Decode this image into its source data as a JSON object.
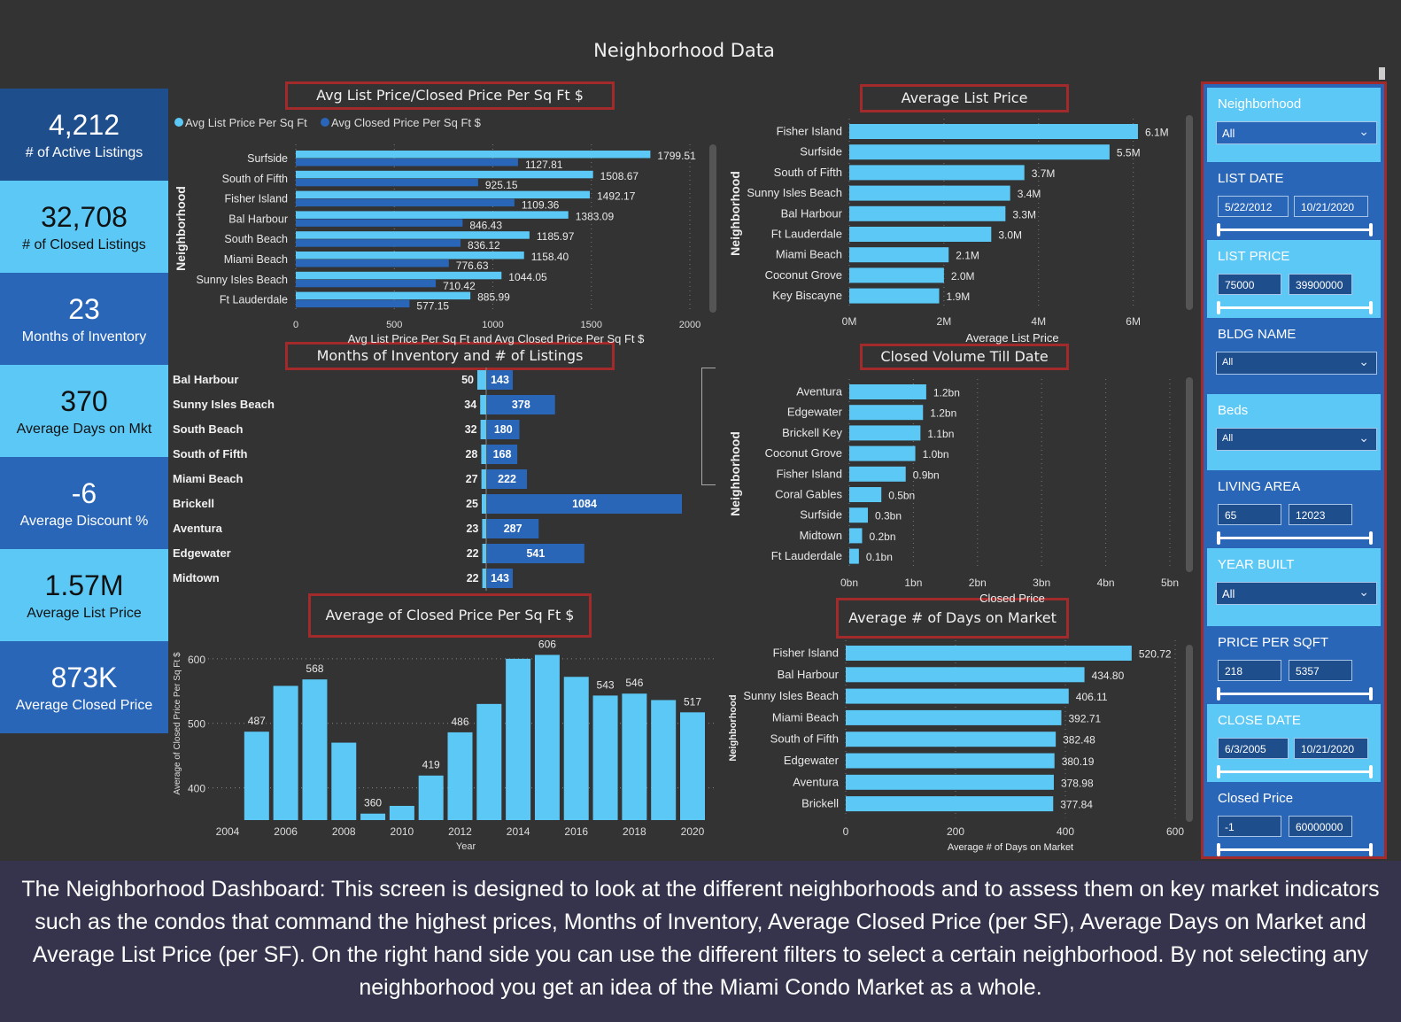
{
  "header": {
    "title": "Neighborhood Data"
  },
  "kpis": [
    {
      "value": "4,212",
      "label": "# of Active Listings"
    },
    {
      "value": "32,708",
      "label": "# of Closed Listings"
    },
    {
      "value": "23",
      "label": "Months of Inventory"
    },
    {
      "value": "370",
      "label": "Average Days on Mkt"
    },
    {
      "value": "-6",
      "label": "Average Discount %"
    },
    {
      "value": "1.57M",
      "label": "Average List Price"
    },
    {
      "value": "873K",
      "label": "Average Closed Price"
    }
  ],
  "colors": {
    "light_blue": "#5bc8f5",
    "mid_blue": "#2a66b8",
    "dark_blue": "#1f4e8c",
    "title_border": "#a32a2a",
    "background": "#333333"
  },
  "chart_data": [
    {
      "id": "ppsf",
      "type": "bar",
      "orientation": "horizontal",
      "title": "Avg List Price/Closed Price Per Sq Ft $",
      "xlabel": "Avg List Price Per Sq Ft and Avg Closed Price Per Sq Ft $",
      "ylabel": "Neighborhood",
      "legend": [
        "Avg List Price Per Sq Ft",
        "Avg Closed Price Per Sq Ft $"
      ],
      "legend_position": "top-left",
      "categories": [
        "Surfside",
        "South of Fifth",
        "Fisher Island",
        "Bal Harbour",
        "South Beach",
        "Miami Beach",
        "Sunny Isles Beach",
        "Ft Lauderdale"
      ],
      "series": [
        {
          "name": "Avg List Price Per Sq Ft",
          "values": [
            1799.51,
            1508.67,
            1492.17,
            1383.09,
            1185.97,
            1158.4,
            1044.05,
            885.99
          ]
        },
        {
          "name": "Avg Closed Price Per Sq Ft $",
          "values": [
            1127.81,
            925.15,
            1109.36,
            846.43,
            836.12,
            776.63,
            710.42,
            577.15
          ]
        }
      ],
      "xlim": [
        0,
        2000
      ],
      "xticks": [
        0,
        500,
        1000,
        1500,
        2000
      ],
      "grid": true
    },
    {
      "id": "moi",
      "type": "bar",
      "orientation": "horizontal",
      "title": "Months of Inventory and # of Listings",
      "categories": [
        "Bal Harbour",
        "Sunny Isles Beach",
        "South Beach",
        "South of Fifth",
        "Miami Beach",
        "Brickell",
        "Aventura",
        "Edgewater",
        "Midtown"
      ],
      "series": [
        {
          "name": "Months of Inventory",
          "values": [
            50,
            34,
            32,
            28,
            27,
            25,
            23,
            22,
            22
          ]
        },
        {
          "name": "# of Listings",
          "values": [
            143,
            378,
            180,
            168,
            222,
            1084,
            287,
            541,
            143
          ]
        }
      ]
    },
    {
      "id": "avglist",
      "type": "bar",
      "orientation": "horizontal",
      "title": "Average List Price",
      "xlabel": "Average List Price",
      "ylabel": "Neighborhood",
      "categories": [
        "Fisher Island",
        "Surfside",
        "South of Fifth",
        "Sunny Isles Beach",
        "Bal Harbour",
        "Ft Lauderdale",
        "Miami Beach",
        "Coconut Grove",
        "Key Biscayne"
      ],
      "values": [
        6.1,
        5.5,
        3.7,
        3.4,
        3.3,
        3.0,
        2.1,
        2.0,
        1.9
      ],
      "labels": [
        "6.1M",
        "5.5M",
        "3.7M",
        "3.4M",
        "3.3M",
        "3.0M",
        "2.1M",
        "2.0M",
        "1.9M"
      ],
      "xlim": [
        0,
        6.4
      ],
      "xticks": [
        0,
        2,
        4,
        6
      ],
      "xtick_labels": [
        "0M",
        "2M",
        "4M",
        "6M"
      ],
      "grid": true
    },
    {
      "id": "volume",
      "type": "bar",
      "orientation": "horizontal",
      "title": "Closed Volume Till Date",
      "xlabel": "Closed Price",
      "ylabel": "Neighborhood",
      "categories": [
        "Aventura",
        "Edgewater",
        "Brickell Key",
        "Coconut Grove",
        "Fisher Island",
        "Coral Gables",
        "Surfside",
        "Midtown",
        "Ft Lauderdale"
      ],
      "values": [
        1.2,
        1.15,
        1.11,
        1.03,
        0.88,
        0.5,
        0.29,
        0.2,
        0.15
      ],
      "labels": [
        "1.2bn",
        "1.2bn",
        "1.1bn",
        "1.0bn",
        "0.9bn",
        "0.5bn",
        "0.3bn",
        "0.2bn",
        "0.1bn"
      ],
      "xlim": [
        0,
        5
      ],
      "xticks": [
        0,
        1,
        2,
        3,
        4,
        5
      ],
      "xtick_labels": [
        "0bn",
        "1bn",
        "2bn",
        "3bn",
        "4bn",
        "5bn"
      ],
      "grid": true
    },
    {
      "id": "yearly",
      "type": "bar",
      "title": "Average of Closed Price Per Sq Ft $",
      "xlabel": "Year",
      "ylabel": "Average of Closed Price Per Sq Ft $",
      "categories": [
        2005,
        2006,
        2007,
        2008,
        2009,
        2010,
        2011,
        2012,
        2013,
        2014,
        2015,
        2016,
        2017,
        2018,
        2019,
        2020
      ],
      "values": [
        487,
        558,
        568,
        470,
        360,
        372,
        419,
        486,
        530,
        600,
        606,
        572,
        543,
        546,
        536,
        517
      ],
      "labels": [
        "487",
        "",
        "568",
        "",
        "360",
        "",
        "419",
        "486",
        "",
        "",
        "606",
        "",
        "543",
        "546",
        "",
        "517"
      ],
      "ylim": [
        350,
        630
      ],
      "yticks": [
        400,
        500,
        600
      ],
      "xticks": [
        2004,
        2006,
        2008,
        2010,
        2012,
        2014,
        2016,
        2018,
        2020
      ],
      "grid": true
    },
    {
      "id": "dom",
      "type": "bar",
      "orientation": "horizontal",
      "title": "Average # of Days on Market",
      "xlabel": "Average # of Days on Market",
      "ylabel": "Neighborhood",
      "categories": [
        "Fisher Island",
        "Bal Harbour",
        "Sunny Isles Beach",
        "Miami Beach",
        "South of Fifth",
        "Edgewater",
        "Aventura",
        "Brickell"
      ],
      "values": [
        520.72,
        434.8,
        406.11,
        392.71,
        382.48,
        380.19,
        378.98,
        377.84
      ],
      "labels": [
        "520.72",
        "434.80",
        "406.11",
        "392.71",
        "382.48",
        "380.19",
        "378.98",
        "377.84"
      ],
      "xlim": [
        0,
        600
      ],
      "xticks": [
        0,
        200,
        400,
        600
      ],
      "grid": true
    }
  ],
  "filters": {
    "neighborhood": {
      "title": "Neighborhood",
      "value": "All"
    },
    "list_date": {
      "title": "LIST DATE",
      "from": "5/22/2012",
      "to": "10/21/2020"
    },
    "list_price": {
      "title": "LIST PRICE",
      "from": "75000",
      "to": "39900000"
    },
    "bldg_name": {
      "title": "BLDG NAME",
      "value": "All"
    },
    "beds": {
      "title": "Beds",
      "value": "All"
    },
    "living_area": {
      "title": "LIVING AREA",
      "from": "65",
      "to": "12023"
    },
    "year_built": {
      "title": "YEAR BUILT",
      "value": "All"
    },
    "price_per_sqft": {
      "title": "PRICE PER SQFT",
      "from": "218",
      "to": "5357"
    },
    "close_date": {
      "title": "CLOSE DATE",
      "from": "6/3/2005",
      "to": "10/21/2020"
    },
    "closed_price": {
      "title": "Closed Price",
      "from": "-1",
      "to": "60000000"
    }
  },
  "caption": "The Neighborhood Dashboard: This screen is designed to look at the different neighborhoods and to assess them on key market indicators such as the condos that command the highest prices, Months of Inventory, Average Closed Price (per SF), Average Days on Market and Average List Price (per SF). On the right hand side you can use the different filters to select a certain neighborhood. By not selecting any neighborhood you get an idea of the Miami Condo Market as a whole."
}
